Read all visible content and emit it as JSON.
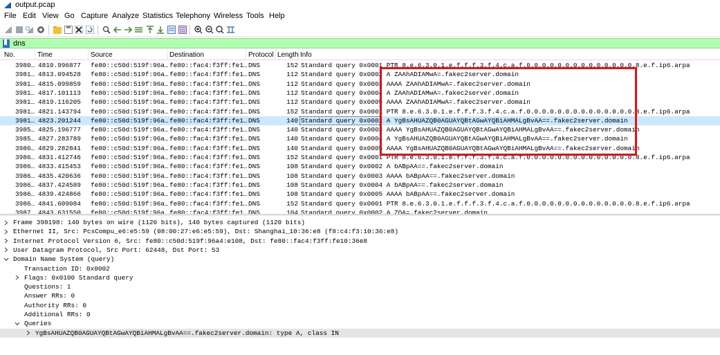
{
  "window": {
    "title": "output.pcap"
  },
  "menu": [
    "File",
    "Edit",
    "View",
    "Go",
    "Capture",
    "Analyze",
    "Statistics",
    "Telephony",
    "Wireless",
    "Tools",
    "Help"
  ],
  "toolbar": {
    "buttons": [
      "start-capture-icon",
      "stop-capture-icon",
      "restart-capture-icon",
      "capture-options-icon",
      "open-file-icon",
      "save-file-icon",
      "close-file-icon",
      "reload-file-icon",
      "find-packet-icon",
      "go-back-icon",
      "go-forward-icon",
      "go-to-packet-icon",
      "go-first-icon",
      "go-last-icon",
      "autoscroll-icon",
      "colorize-icon",
      "zoom-in-icon",
      "zoom-out-icon",
      "zoom-normal-icon",
      "resize-columns-icon"
    ]
  },
  "filter": {
    "value": "dns",
    "color": "#afffaf"
  },
  "packet_list": {
    "columns": [
      "No.",
      "Time",
      "Source",
      "Destination",
      "Protocol",
      "Length",
      "Info"
    ],
    "rows": [
      {
        "no": "3980…",
        "time": "4810.996877",
        "src": "fe80::c50d:519f:96a…",
        "dst": "fe80::fac4:f3ff:fe1…",
        "proto": "DNS",
        "len": "152",
        "info": "Standard query 0x0001 PTR 8.e.6.3.0.1.e.f.f.f.3.f.4.c.a.f.0.0.0.0.0.0.0.0.0.0.0.0.0.0.8.e.f.ip6.arpa"
      },
      {
        "no": "3981…",
        "time": "4813.094528",
        "src": "fe80::c50d:519f:96a…",
        "dst": "fe80::fac4:f3ff:fe1…",
        "proto": "DNS",
        "len": "112",
        "info": "Standard query 0x0002 A ZAAhADIAMwA=.fakec2server.domain"
      },
      {
        "no": "3981…",
        "time": "4815.099859",
        "src": "fe80::c50d:519f:96a…",
        "dst": "fe80::fac4:f3ff:fe1…",
        "proto": "DNS",
        "len": "112",
        "info": "Standard query 0x0003 AAAA ZAAhADIAMwA=.fakec2server.domain"
      },
      {
        "no": "3981…",
        "time": "4817.101113",
        "src": "fe80::c50d:519f:96a…",
        "dst": "fe80::fac4:f3ff:fe1…",
        "proto": "DNS",
        "len": "112",
        "info": "Standard query 0x0004 A ZAAhADIAMwA=.fakec2server.domain"
      },
      {
        "no": "3981…",
        "time": "4819.116205",
        "src": "fe80::c50d:519f:96a…",
        "dst": "fe80::fac4:f3ff:fe1…",
        "proto": "DNS",
        "len": "112",
        "info": "Standard query 0x0005 AAAA ZAAhADIAMwA=.fakec2server.domain"
      },
      {
        "no": "3981…",
        "time": "4821.143794",
        "src": "fe80::c50d:519f:96a…",
        "dst": "fe80::fac4:f3ff:fe1…",
        "proto": "DNS",
        "len": "152",
        "info": "Standard query 0x0001 PTR 8.e.6.3.0.1.e.f.f.f.3.f.4.c.a.f.0.0.0.0.0.0.0.0.0.0.0.0.0.0.8.e.f.ip6.arpa"
      },
      {
        "no": "3981…",
        "time": "4823.201244",
        "src": "fe80::c50d:519f:96a…",
        "dst": "fe80::fac4:f3ff:fe1…",
        "proto": "DNS",
        "len": "140",
        "info": "Standard query 0x0002 A YgBsAHUAZQB0AGUAYQBtAGwAYQBiAHMALgBvAA==.fakec2server.domain",
        "selected": true
      },
      {
        "no": "3985…",
        "time": "4825.196777",
        "src": "fe80::c50d:519f:96a…",
        "dst": "fe80::fac4:f3ff:fe1…",
        "proto": "DNS",
        "len": "140",
        "info": "Standard query 0x0003 AAAA YgBsAHUAZQB0AGUAYQBtAGwAYQBiAHMALgBvAA==.fakec2server.domain"
      },
      {
        "no": "3985…",
        "time": "4827.283789",
        "src": "fe80::c50d:519f:96a…",
        "dst": "fe80::fac4:f3ff:fe1…",
        "proto": "DNS",
        "len": "140",
        "info": "Standard query 0x0004 A YgBsAHUAZQB0AGUAYQBtAGwAYQBiAHMALgBvAA==.fakec2server.domain"
      },
      {
        "no": "3986…",
        "time": "4829.282841",
        "src": "fe80::c50d:519f:96a…",
        "dst": "fe80::fac4:f3ff:fe1…",
        "proto": "DNS",
        "len": "140",
        "info": "Standard query 0x0005 AAAA YgBsAHUAZQB0AGUAYQBtAGwAYQBiAHMALgBvAA==.fakec2server.domain"
      },
      {
        "no": "3986…",
        "time": "4831.412746",
        "src": "fe80::c50d:519f:96a…",
        "dst": "fe80::fac4:f3ff:fe1…",
        "proto": "DNS",
        "len": "152",
        "info": "Standard query 0x0001 PTR 8.e.6.3.0.1.e.f.f.f.3.f.4.c.a.f.0.0.0.0.0.0.0.0.0.0.0.0.0.0.8.e.f.ip6.arpa"
      },
      {
        "no": "3986…",
        "time": "4833.415453",
        "src": "fe80::c50d:519f:96a…",
        "dst": "fe80::fac4:f3ff:fe1…",
        "proto": "DNS",
        "len": "108",
        "info": "Standard query 0x0002 A bABpAA==.fakec2server.domain"
      },
      {
        "no": "3986…",
        "time": "4835.420636",
        "src": "fe80::c50d:519f:96a…",
        "dst": "fe80::fac4:f3ff:fe1…",
        "proto": "DNS",
        "len": "108",
        "info": "Standard query 0x0003 AAAA bABpAA==.fakec2server.domain"
      },
      {
        "no": "3986…",
        "time": "4837.424589",
        "src": "fe80::c50d:519f:96a…",
        "dst": "fe80::fac4:f3ff:fe1…",
        "proto": "DNS",
        "len": "108",
        "info": "Standard query 0x0004 A bABpAA==.fakec2server.domain"
      },
      {
        "no": "3986…",
        "time": "4839.424866",
        "src": "fe80::c50d:519f:96a…",
        "dst": "fe80::fac4:f3ff:fe1…",
        "proto": "DNS",
        "len": "108",
        "info": "Standard query 0x0005 AAAA bABpAA==.fakec2server.domain"
      },
      {
        "no": "3986…",
        "time": "4841.609084",
        "src": "fe80::c50d:519f:96a…",
        "dst": "fe80::fac4:f3ff:fe1…",
        "proto": "DNS",
        "len": "152",
        "info": "Standard query 0x0001 PTR 8.e.6.3.0.1.e.f.f.f.3.f.4.c.a.f.0.0.0.0.0.0.0.0.0.0.0.0.0.0.8.e.f.ip6.arpa"
      },
      {
        "no": "3987…",
        "time": "4843.631550",
        "src": "fe80::c50d:519f:96a…",
        "dst": "fe80::fac4:f3ff:fe1…",
        "proto": "DNS",
        "len": "104",
        "info": "Standard query 0x0002 A ZQA=.fakec2server.domain"
      }
    ]
  },
  "details": {
    "rows": [
      {
        "arrow": "right",
        "level": 0,
        "text": "Frame 398198: 140 bytes on wire (1120 bits), 140 bytes captured (1120 bits)"
      },
      {
        "arrow": "right",
        "level": 0,
        "text": "Ethernet II, Src: PcsCompu_e6:e5:59 (08:00:27:e6:e5:59), Dst: Shanghai_10:36:e8 (f8:c4:f3:10:36:e8)"
      },
      {
        "arrow": "right",
        "level": 0,
        "text": "Internet Protocol Version 6, Src: fe80::c50d:519f:96a4:e108, Dst: fe80::fac4:f3ff:fe10:36e8"
      },
      {
        "arrow": "right",
        "level": 0,
        "text": "User Datagram Protocol, Src Port: 62448, Dst Port: 53"
      },
      {
        "arrow": "down",
        "level": 0,
        "text": "Domain Name System (query)"
      },
      {
        "arrow": "none",
        "level": 1,
        "text": "Transaction ID: 0x0002"
      },
      {
        "arrow": "right",
        "level": 1,
        "text": "Flags: 0x0100 Standard query"
      },
      {
        "arrow": "none",
        "level": 1,
        "text": "Questions: 1"
      },
      {
        "arrow": "none",
        "level": 1,
        "text": "Answer RRs: 0"
      },
      {
        "arrow": "none",
        "level": 1,
        "text": "Authority RRs: 0"
      },
      {
        "arrow": "none",
        "level": 1,
        "text": "Additional RRs: 0"
      },
      {
        "arrow": "down",
        "level": 1,
        "text": "Queries"
      },
      {
        "arrow": "right",
        "level": 2,
        "text": "YgBsAHUAZQB0AGUAYQBtAGwAYQBiAHMALgBvAA==.fakec2server.domain: type A, class IN",
        "selected": true
      }
    ]
  },
  "colors": {
    "filter_bg": "#afffaf",
    "selected_row": "#cce8ff",
    "annotation_box": "#e81010"
  }
}
